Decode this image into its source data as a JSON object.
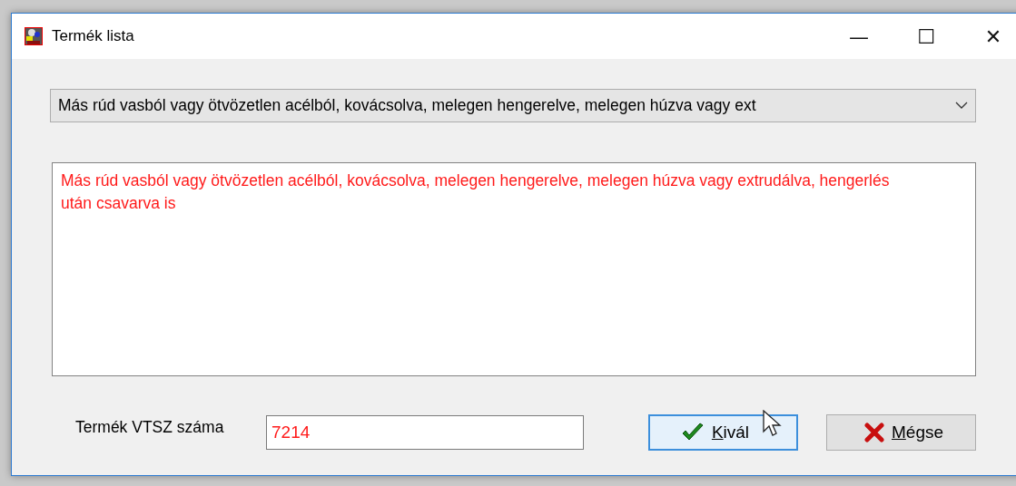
{
  "window": {
    "title": "Termék lista",
    "controls": [
      "—",
      "☐",
      "✕"
    ]
  },
  "combo": {
    "value": "Más rúd vasból vagy ötvözetlen acélból, kovácsolva, melegen hengerelve, melegen húzva vagy ext"
  },
  "memo": {
    "text": "Más rúd vasból vagy ötvözetlen acélból, kovácsolva, melegen hengerelve, melegen húzva vagy extrudálva, hengerlés után csavarva is"
  },
  "vtsz": {
    "label": "Termék VTSZ száma",
    "value": "7214"
  },
  "buttons": [
    {
      "kind": "ok",
      "accel": "K",
      "rest": "ivál",
      "focused": true
    },
    {
      "kind": "cancel",
      "accel": "M",
      "rest": "égse",
      "focused": false
    }
  ]
}
